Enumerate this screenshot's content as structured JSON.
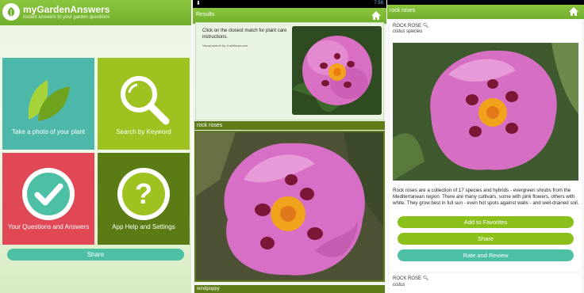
{
  "home": {
    "title": "myGardenAnswers",
    "subtitle": "instant answers to your garden questions",
    "tiles": [
      {
        "label": "Take a photo of your plant",
        "icon": "leaf-icon",
        "color": "#4db8a9"
      },
      {
        "label": "Search by Keyword",
        "icon": "magnifier-icon",
        "color": "#9ec21f"
      },
      {
        "label": "Your Questions and Answers",
        "icon": "checkmark-icon",
        "color": "#e04856"
      },
      {
        "label": "App Help and Settings",
        "icon": "question-icon",
        "color": "#5b7b14"
      }
    ],
    "share_label": "Share"
  },
  "results": {
    "status_time": "7:58",
    "title": "Results",
    "instruction": "Click on the closest match for plant care instructions.",
    "credit": "Visual search by JustVisual.com",
    "item1_label": "rock roses",
    "item2_label": "windpoppy"
  },
  "detail": {
    "title": "rock roses",
    "name": "ROCK ROSE",
    "latin": "cistus species",
    "description": "Rock roses are a collection of 17 species and hybrids - evergreen shrubs from the Mediterranean region. There are many cultivars, some with pink flowers, others with white. They grow best in full sun - even hot spots against walls - and well-drained soil.",
    "buttons": {
      "favorites": "Add to Favorites",
      "share": "Share",
      "rate": "Rate and Review"
    },
    "next_name": "ROCK ROSE",
    "next_latin": "cistus"
  },
  "colors": {
    "accent_green": "#8cc63f",
    "dark_green": "#5e7d19",
    "teal": "#4dbfa4"
  }
}
